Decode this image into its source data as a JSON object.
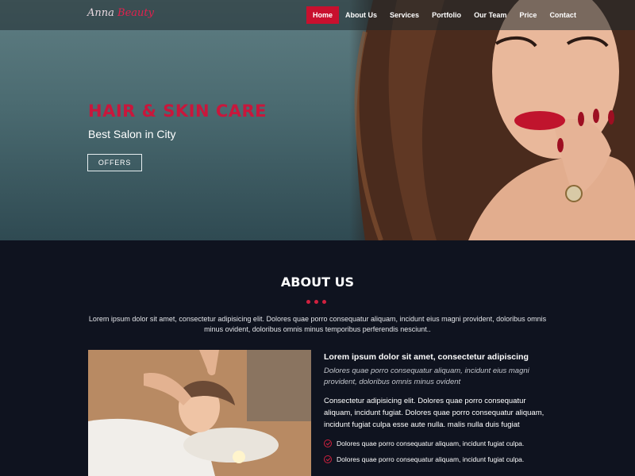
{
  "brand": {
    "logo_script": "Anna",
    "logo_word": "Beauty"
  },
  "nav": {
    "items": [
      {
        "label": "Home",
        "active": true
      },
      {
        "label": "About Us"
      },
      {
        "label": "Services"
      },
      {
        "label": "Portfolio"
      },
      {
        "label": "Our Team"
      },
      {
        "label": "Price"
      },
      {
        "label": "Contact"
      }
    ]
  },
  "hero": {
    "title": "HAIR & SKIN CARE",
    "subtitle": "Best Salon in City",
    "button_label": "OFFERS"
  },
  "about": {
    "title": "ABOUT US",
    "description": "Lorem ipsum dolor sit amet, consectetur adipisicing elit. Dolores quae porro consequatur aliquam, incidunt eius magni provident, doloribus omnis minus ovident, doloribus omnis minus temporibus perferendis nesciunt..",
    "heading": "Lorem ipsum dolor sit amet, consectetur adipiscing",
    "italic_text": "Dolores quae porro consequatur aliquam, incidunt eius magni provident, doloribus omnis minus ovident",
    "paragraph": "Consectetur adipisicing elit. Dolores quae porro consequatur aliquam, incidunt fugiat. Dolores quae porro consequatur aliquam, incidunt fugiat culpa esse aute nulla. malis nulla duis fugiat",
    "checklist": [
      "Dolores quae porro consequatur aliquam, incidunt fugiat culpa.",
      "Dolores quae porro consequatur aliquam, incidunt fugiat culpa."
    ]
  },
  "colors": {
    "accent": "#c8102e",
    "background": "#0f131f",
    "hero_bg": "#4f6e74"
  }
}
